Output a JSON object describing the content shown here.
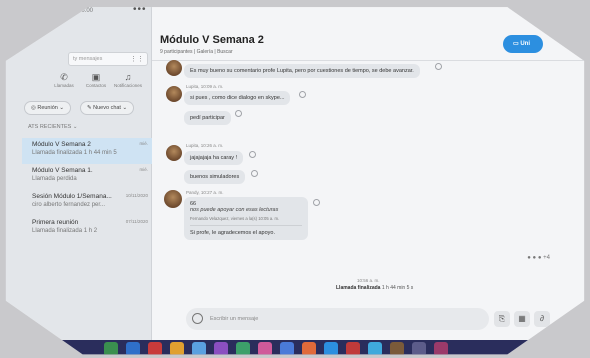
{
  "sidebar": {
    "user_text": "ez  $0.00",
    "more": "•••",
    "search_placeholder": "ty mensajes",
    "nav": [
      {
        "label": "Llamadas",
        "icon": "phone-icon"
      },
      {
        "label": "Contactos",
        "icon": "contacts-icon"
      },
      {
        "label": "Notificaciones",
        "icon": "bell-icon"
      }
    ],
    "meet_label": "Reunión",
    "newchat_label": "Nuevo chat",
    "recents_label": "ATS RECIENTES",
    "chats": [
      {
        "title": "Módulo V Semana 2",
        "sub": "Llamada finalizada 1 h 44 min 5",
        "time": "mié."
      },
      {
        "title": "Módulo V Semana 1.",
        "sub": "Llamada perdida",
        "time": "mié."
      },
      {
        "title": "Sesión Módulo 1/Semana...",
        "sub": "ciro alberto fernandez per...",
        "time": "10/11/2020"
      },
      {
        "title": "Primera reunión",
        "sub": "Llamada finalizada 1 h 2",
        "time": "07/11/2020"
      }
    ]
  },
  "chat": {
    "title": "Módulo V Semana 2",
    "subtitle": "9 participantes  |  Galería  |  Buscar",
    "call_label": "Uni",
    "messages": {
      "m1": "Es muy bueno su comentario profe Lupita, pero por cuestiones de tiempo, se debe avanzar.",
      "meta2": "Lupita, 10:09 a. m.",
      "m2": "si pues , como dice dialogo en skype...",
      "m3": "pedí participar",
      "meta3": "Lupita, 10:26 a. m.",
      "m4": "jajajajaja ha caray !",
      "m5": "buenos simuladores",
      "meta4": "Pandy, 10:27 a. m.",
      "quote_mark": "66",
      "quote": "nos puede apoyar con esas lecturas",
      "quote_meta": "Fernando Velazquez, viernes a la(s) 10:05 a. m.",
      "m6": "Si profe, le agradecemos el apoyo."
    },
    "reactions": "+4",
    "call_end_time": "10:56 a. m.",
    "call_end_label": "Llamada finalizada",
    "call_end_duration": "1 h 44 min 5 s",
    "composer_placeholder": "Escribir un mensaje"
  }
}
